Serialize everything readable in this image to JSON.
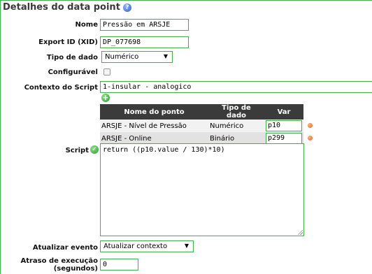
{
  "title": "Detalhes do data point",
  "fields": {
    "name_label": "Nome",
    "name_value": "Pressão em ARSJE",
    "xid_label": "Export ID (XID)",
    "xid_value": "DP_077698",
    "datatype_label": "Tipo de dado",
    "datatype_value": "Numérico",
    "settable_label": "Configurável",
    "context_label": "Contexto do Script",
    "context_value": "1-insular - analogico",
    "script_label": "Script",
    "script_value": "return ((p10.value / 130)*10)",
    "update_label": "Atualizar evento",
    "update_value": "Atualizar contexto",
    "delay_label": "Atraso de execução (segundos)",
    "delay_value": "0"
  },
  "var_table": {
    "headers": [
      "Nome do ponto",
      "Tipo de dado",
      "Var"
    ],
    "rows": [
      {
        "name": "ARSJE - Nível de Pressão",
        "type": "Numérico",
        "var": "p10"
      },
      {
        "name": "ARSJE - Online",
        "type": "Binário",
        "var": "p299"
      }
    ]
  },
  "colors": {
    "border_green": "#39b54a",
    "table_header_bg": "#3b3b3b"
  }
}
